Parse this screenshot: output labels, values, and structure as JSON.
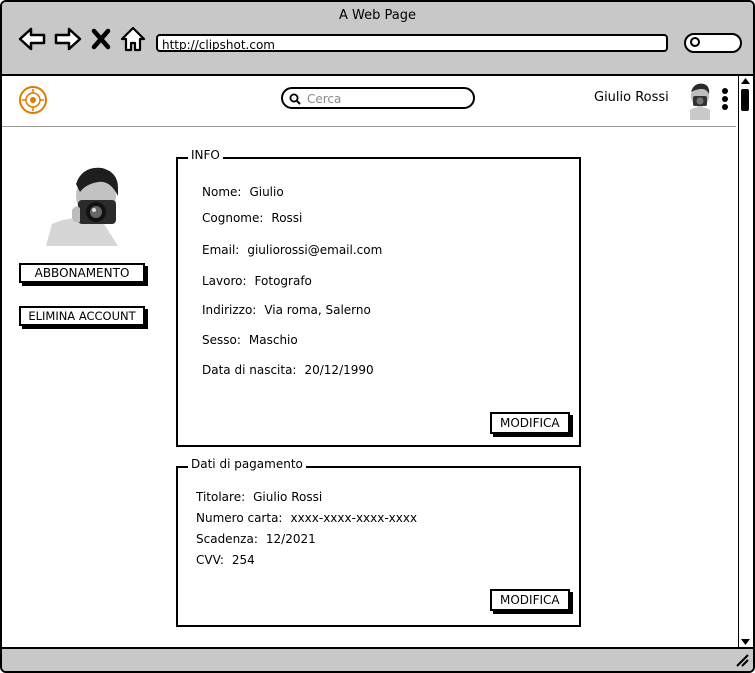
{
  "browser": {
    "title": "A Web Page",
    "url": "http://clipshot.com",
    "icons": {
      "back": "arrow-left-icon",
      "forward": "arrow-right-icon",
      "stop": "close-icon",
      "home": "home-icon",
      "search": "search-icon"
    }
  },
  "header": {
    "logo_icon": "logo-icon",
    "search_placeholder": "Cerca",
    "username": "Giulio Rossi",
    "avatar_icon": "avatar-icon",
    "menu_icon": "kebab-menu-icon"
  },
  "sidebar": {
    "avatar_icon": "profile-photo",
    "subscription_label": "ABBONAMENTO",
    "delete_label": "ELIMINA ACCOUNT"
  },
  "info": {
    "legend": "INFO",
    "fields": [
      {
        "label": "Nome:",
        "value": "Giulio"
      },
      {
        "label": "Cognome:",
        "value": "Rossi"
      },
      {
        "label": "Email:",
        "value": "giuliorossi@email.com"
      },
      {
        "label": "Lavoro:",
        "value": "Fotografo"
      },
      {
        "label": "Indirizzo:",
        "value": "Via roma, Salerno"
      },
      {
        "label": "Sesso:",
        "value": "Maschio"
      },
      {
        "label": "Data di nascita:",
        "value": "20/12/1990"
      }
    ],
    "edit_label": "MODIFICA"
  },
  "payment": {
    "legend": "Dati di pagamento",
    "fields": [
      {
        "label": "Titolare:",
        "value": "Giulio Rossi"
      },
      {
        "label": "Numero carta:",
        "value": "xxxx-xxxx-xxxx-xxxx"
      },
      {
        "label": "Scadenza:",
        "value": "12/2021"
      },
      {
        "label": "CVV:",
        "value": "254"
      }
    ],
    "edit_label": "MODIFICA"
  },
  "colors": {
    "chrome": "#c8c8c8",
    "logo_accent": "#e07b00",
    "border": "#000000"
  }
}
